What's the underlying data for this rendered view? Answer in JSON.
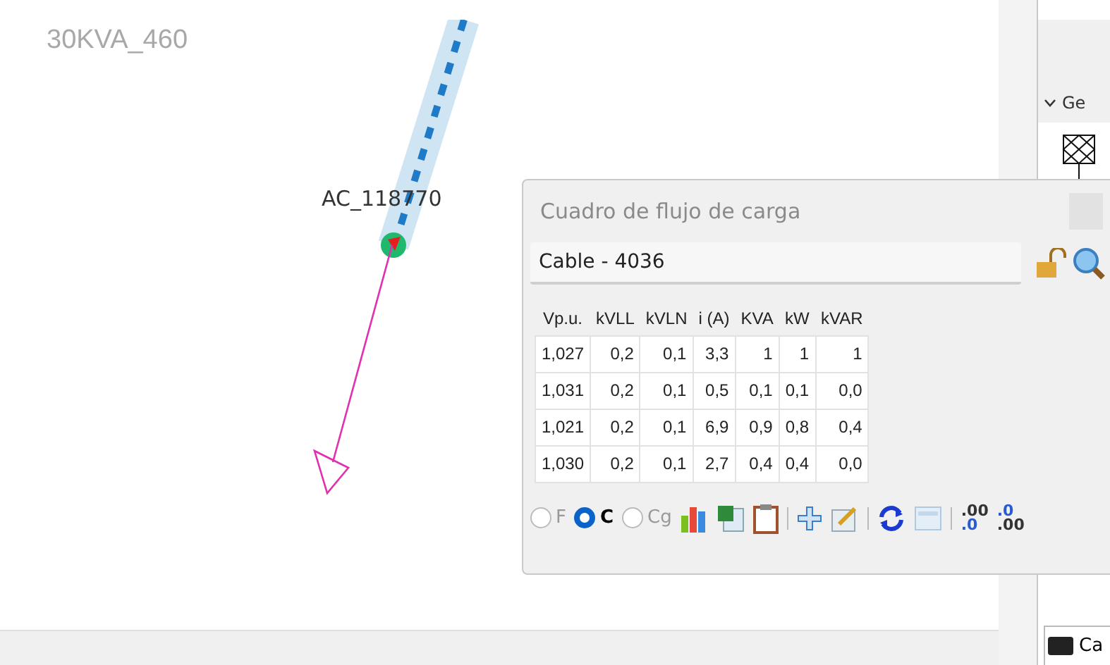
{
  "canvas": {
    "title_label": "30KVA_460",
    "node_label": "AC_118770"
  },
  "side_panel": {
    "group": "Ge",
    "tab": "Ca"
  },
  "dialog": {
    "title": "Cuadro de flujo de carga",
    "element": "Cable - 4036",
    "table": {
      "columns": [
        "Vp.u.",
        "kVLL",
        "kVLN",
        "i (A)",
        "KVA",
        "kW",
        "kVAR"
      ],
      "rows": [
        [
          "1,027",
          "0,2",
          "0,1",
          "3,3",
          "1",
          "1",
          "1"
        ],
        [
          "1,031",
          "0,2",
          "0,1",
          "0,5",
          "0,1",
          "0,1",
          "0,0"
        ],
        [
          "1,021",
          "0,2",
          "0,1",
          "6,9",
          "0,9",
          "0,8",
          "0,4"
        ],
        [
          "1,030",
          "0,2",
          "0,1",
          "2,7",
          "0,4",
          "0,4",
          "0,0"
        ]
      ]
    },
    "phases": [
      {
        "label": "F",
        "selected": false
      },
      {
        "label": "C",
        "selected": true
      },
      {
        "label": "Cg",
        "selected": false
      }
    ],
    "decimals": [
      {
        "top": ".00",
        "bottom": ".0"
      },
      {
        "top": ".0",
        "bottom": ".00"
      }
    ]
  }
}
